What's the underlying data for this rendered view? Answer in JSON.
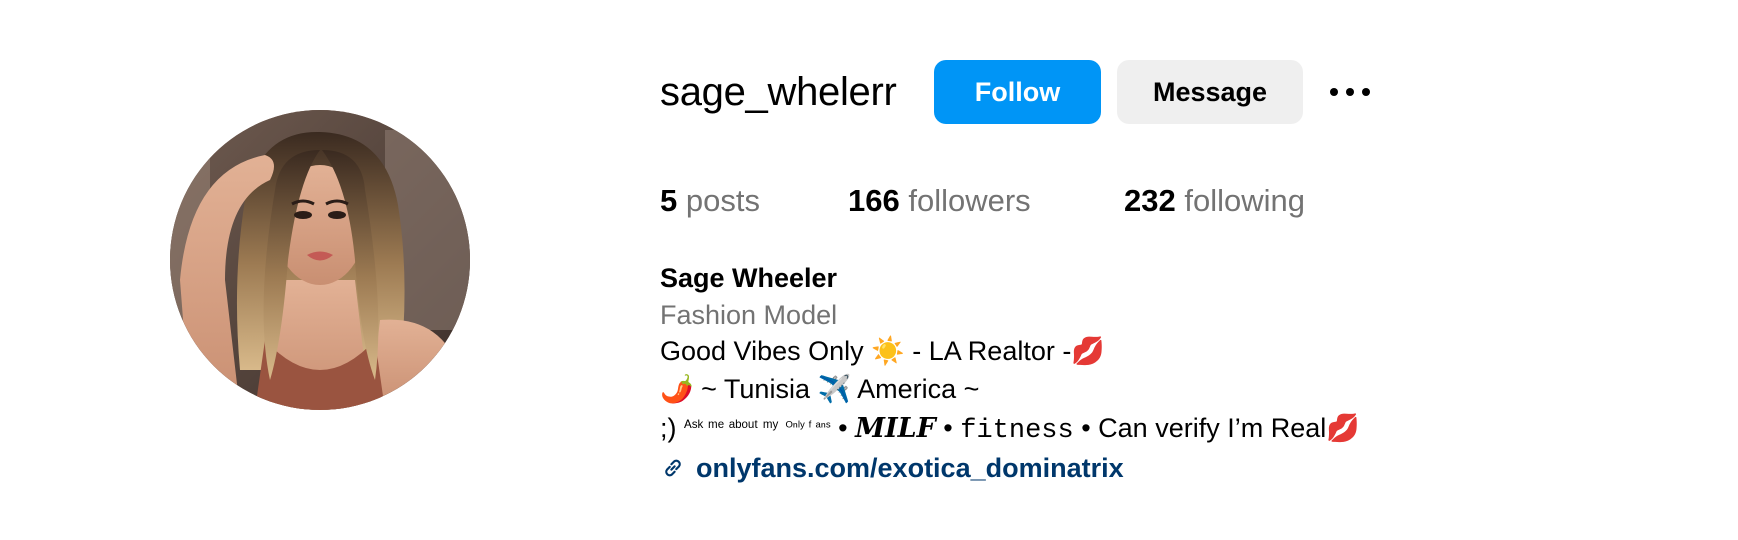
{
  "profile": {
    "username": "sage_whelerr",
    "avatar_icon": "profile-photo-avatar"
  },
  "actions": {
    "follow_label": "Follow",
    "message_label": "Message",
    "more_icon": "more-options-icon"
  },
  "stats": {
    "posts_count": "5",
    "posts_label": "posts",
    "followers_count": "166",
    "followers_label": "followers",
    "following_count": "232",
    "following_label": "following"
  },
  "bio": {
    "name": "Sage Wheeler",
    "category": "Fashion Model",
    "line1_a": "Good Vibes Only",
    "line1_sun": "☀️",
    "line1_b": "- LA Realtor -",
    "line1_kiss": "💋",
    "line2_pepper": "🌶️",
    "line2_a": "~ Tunisia",
    "line2_plane": "✈️",
    "line2_b": "America ~",
    "line3_a": ";)",
    "line3_ask": "ᴬˢᵏ ᵐᵉ ᵃᵇᵒᵘᵗ ᵐʸ",
    "line3_only": "ᴼⁿˡʸ ᶠ ᵃⁿˢ",
    "line3_sep1": "•",
    "line3_milf": "MILF",
    "line3_sep2": "•",
    "line3_fitness": "fitness",
    "line3_sep3": "•",
    "line3_b": "Can verify I’m Real",
    "line3_kiss": "💋",
    "link": "onlyfans.com/exotica_dominatrix",
    "link_icon": "link-icon"
  },
  "colors": {
    "follow_button": "#0095f6",
    "message_button": "#efefef",
    "secondary_text": "#737373",
    "link_text": "#00376b"
  }
}
